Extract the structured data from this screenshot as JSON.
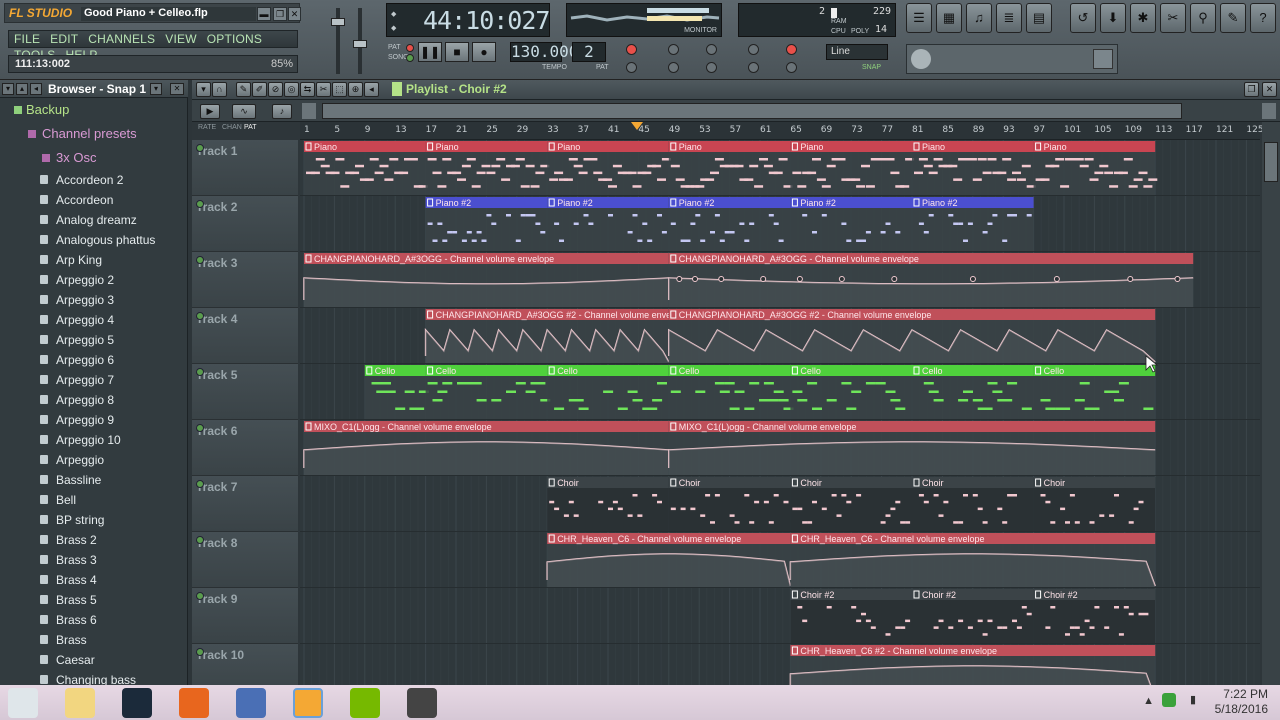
{
  "app": {
    "logo": "FL STUDIO",
    "song_title": "Good Piano + Celleo.flp",
    "menu": [
      "FILE",
      "EDIT",
      "CHANNELS",
      "VIEW",
      "OPTIONS",
      "TOOLS",
      "HELP"
    ],
    "hint_time": "111:13:002",
    "hint_pct": "85%"
  },
  "transport": {
    "song_time": "44:10:027",
    "tempo": "130.000",
    "pattern": "2",
    "tempo_label": "TEMPO",
    "pat_label": "PAT",
    "pat_song": [
      "PAT",
      "SONG"
    ],
    "monitor_label": "MONITOR",
    "snap_mode": "Line",
    "snap_label": "SNAP",
    "cpu_labels": [
      "RAM",
      "CPU",
      "POLY"
    ],
    "cpu_values": [
      "2",
      "229",
      "14"
    ]
  },
  "browser": {
    "title": "Browser - Snap 1",
    "folders": [
      "Backup",
      "Channel presets",
      "3x Osc"
    ],
    "items": [
      "Accordeon 2",
      "Accordeon",
      "Analog dreamz",
      "Analogous phattus",
      "Arp King",
      "Arpeggio 2",
      "Arpeggio 3",
      "Arpeggio 4",
      "Arpeggio 5",
      "Arpeggio 6",
      "Arpeggio 7",
      "Arpeggio 8",
      "Arpeggio 9",
      "Arpeggio 10",
      "Arpeggio",
      "Bassline",
      "Bell",
      "BP string",
      "Brass 2",
      "Brass 3",
      "Brass 4",
      "Brass 5",
      "Brass 6",
      "Brass",
      "Caesar",
      "Changing bass"
    ]
  },
  "playlist": {
    "title": "Playlist - Choir #2",
    "ruler_labels": [
      "RATE",
      "CHAN",
      "PAT"
    ],
    "bars": [
      "1",
      "5",
      "9",
      "13",
      "17",
      "21",
      "25",
      "29",
      "33",
      "37",
      "41",
      "45",
      "49",
      "53",
      "57",
      "61",
      "65",
      "69",
      "73",
      "77",
      "81",
      "85",
      "89",
      "93",
      "97",
      "101",
      "105",
      "109",
      "113",
      "117",
      "121",
      "125"
    ],
    "tracks": [
      "Track 1",
      "Track 2",
      "Track 3",
      "Track 4",
      "Track 5",
      "Track 6",
      "Track 7",
      "Track 8",
      "Track 9",
      "Track 10"
    ],
    "clips": [
      {
        "track": 1,
        "name": "Piano",
        "color": "#c94552",
        "kind": "notes",
        "segments": [
          [
            1,
            17
          ],
          [
            17,
            33
          ],
          [
            33,
            49
          ],
          [
            49,
            65
          ],
          [
            65,
            81
          ],
          [
            81,
            97
          ],
          [
            97,
            113
          ]
        ]
      },
      {
        "track": 2,
        "name": "Piano #2",
        "color": "#4b4fd0",
        "kind": "notes",
        "segments": [
          [
            17,
            33
          ],
          [
            33,
            49
          ],
          [
            49,
            65
          ],
          [
            65,
            81
          ],
          [
            81,
            97
          ]
        ]
      },
      {
        "track": 3,
        "name": "CHANGPIANOHARD_A#3OGG - Channel volume envelope",
        "color": "#c0505a",
        "kind": "envelope",
        "segments": [
          [
            1,
            49
          ],
          [
            49,
            118
          ]
        ]
      },
      {
        "track": 4,
        "name": "CHANGPIANOHARD_A#3OGG #2 - Channel volume envelope",
        "color": "#c0505a",
        "kind": "envelope",
        "segments": [
          [
            17,
            49
          ],
          [
            49,
            113
          ]
        ]
      },
      {
        "track": 5,
        "name": "Cello",
        "color": "#4fd13c",
        "kind": "notes",
        "segments": [
          [
            9,
            17
          ],
          [
            17,
            33
          ],
          [
            33,
            49
          ],
          [
            49,
            65
          ],
          [
            65,
            81
          ],
          [
            81,
            97
          ],
          [
            97,
            113
          ]
        ]
      },
      {
        "track": 6,
        "name": "MIXO_C1(L)ogg - Channel volume envelope",
        "color": "#c0505a",
        "kind": "envelope",
        "segments": [
          [
            1,
            49
          ],
          [
            49,
            113
          ]
        ]
      },
      {
        "track": 7,
        "name": "Choir",
        "color": "#3b4347",
        "kind": "notes",
        "segments": [
          [
            33,
            49
          ],
          [
            49,
            65
          ],
          [
            65,
            81
          ],
          [
            81,
            97
          ],
          [
            97,
            113
          ]
        ]
      },
      {
        "track": 8,
        "name": "CHR_Heaven_C6 - Channel volume envelope",
        "color": "#c0505a",
        "kind": "envelope",
        "segments": [
          [
            33,
            65
          ],
          [
            65,
            113
          ]
        ]
      },
      {
        "track": 9,
        "name": "Choir #2",
        "color": "#3b4347",
        "kind": "notes",
        "segments": [
          [
            65,
            81
          ],
          [
            81,
            97
          ],
          [
            97,
            113
          ]
        ]
      },
      {
        "track": 10,
        "name": "CHR_Heaven_C6 #2 - Channel volume envelope",
        "color": "#c0505a",
        "kind": "envelope",
        "segments": [
          [
            65,
            113
          ]
        ]
      }
    ]
  },
  "taskbar": {
    "time": "7:22 PM",
    "date": "5/18/2016",
    "apps": [
      "start-icon",
      "file-explorer-icon",
      "steam-icon",
      "firefox-icon",
      "audacity-icon",
      "fl-studio-icon",
      "nvidia-icon",
      "video-editor-icon"
    ]
  }
}
